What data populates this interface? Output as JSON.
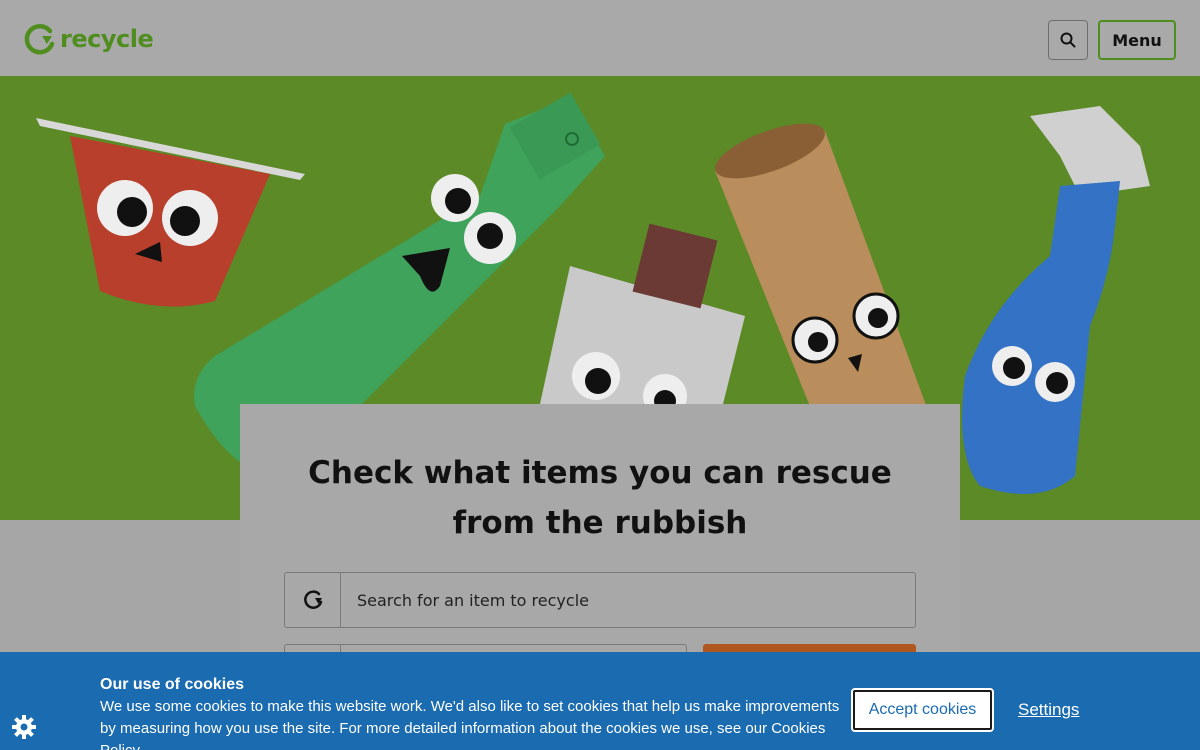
{
  "header": {
    "logo_text": "recycle",
    "search_icon": "search-icon",
    "menu_label": "Menu"
  },
  "colors": {
    "brand_green": "#4f8e1e",
    "hero_green": "#5c8a27",
    "accent_orange": "#b0561f",
    "cookie_blue": "#1a6bb0"
  },
  "search": {
    "title": "Check what items you can rescue from the rubbish",
    "item_placeholder": "Search for an item to recycle",
    "item_icon": "recycle-icon"
  },
  "cookies": {
    "title": "Our use of cookies",
    "text": "We use some cookies to make this website work. We'd also like to set cookies that help us make improvements by measuring how you use the site. For more detailed information about the cookies we use, see our Cookies Policy.",
    "accept_label": "Accept cookies",
    "settings_label": "Settings",
    "icon": "gear-icon"
  }
}
